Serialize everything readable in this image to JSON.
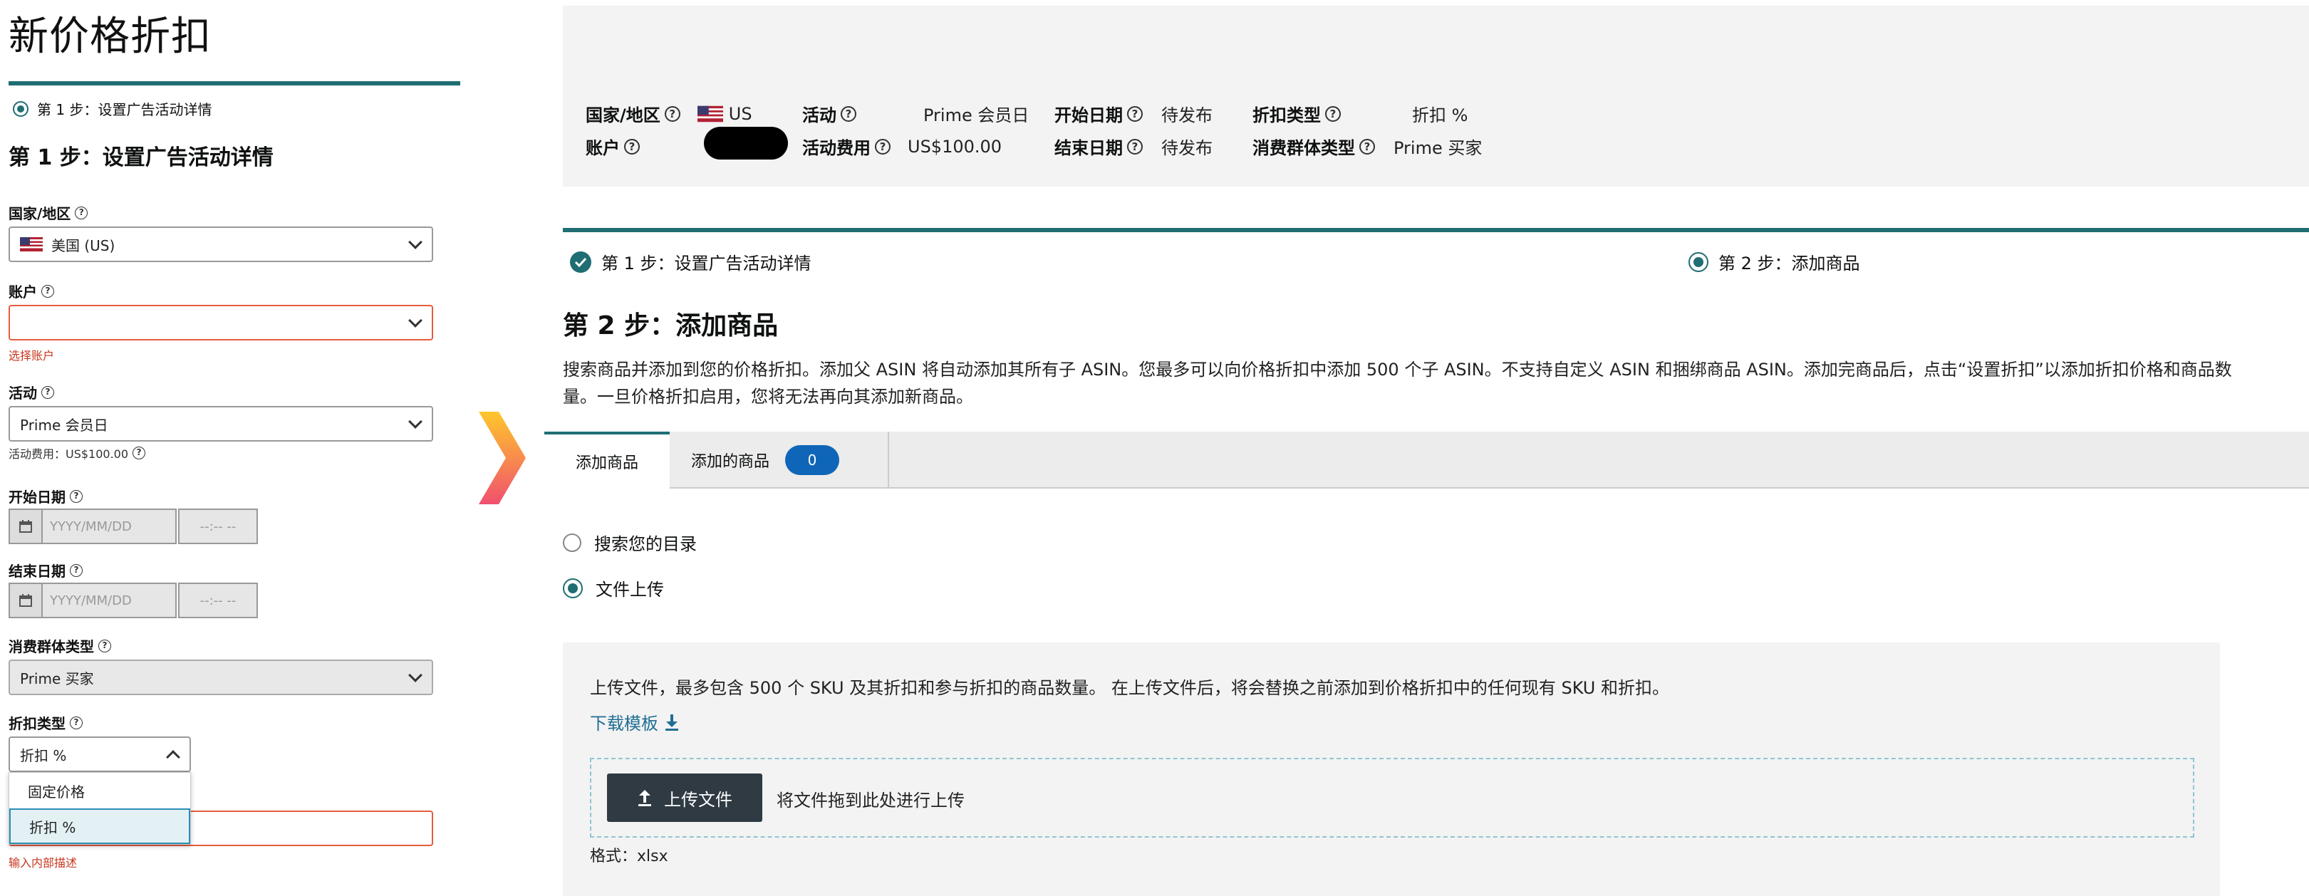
{
  "left": {
    "title": "新价格折扣",
    "step_indicator": "第 1 步：设置广告活动详情",
    "heading": "第 1 步：设置广告活动详情",
    "country_label": "国家/地区",
    "country_value": "美国 (US)",
    "account_label": "账户",
    "account_value": "",
    "account_error": "选择账户",
    "event_label": "活动",
    "event_value": "Prime 会员日",
    "event_fee_text": "活动费用：US$100.00",
    "start_label": "开始日期",
    "start_placeholder": "YYYY/MM/DD",
    "start_time": "--:--  --",
    "end_label": "结束日期",
    "end_placeholder": "YYYY/MM/DD",
    "end_time": "--:--  --",
    "audience_label": "消费群体类型",
    "audience_value": "Prime 买家",
    "discount_type_label": "折扣类型",
    "discount_type_value": "折扣 %",
    "discount_options": [
      "固定价格",
      "折扣 %"
    ],
    "internal_desc_error": "输入内部描述"
  },
  "summary": {
    "country_label": "国家/地区",
    "country_value": "US",
    "account_label": "账户",
    "event_label": "活动",
    "event_value": "Prime 会员日",
    "event_fee_label": "活动费用",
    "event_fee_value": "US$100.00",
    "start_label": "开始日期",
    "start_value": "待发布",
    "end_label": "结束日期",
    "end_value": "待发布",
    "discount_type_label": "折扣类型",
    "discount_type_value": "折扣 %",
    "audience_label": "消费群体类型",
    "audience_value": "Prime 买家"
  },
  "steps": {
    "step1": "第 1 步：设置广告活动详情",
    "step2": "第 2 步：添加商品"
  },
  "main": {
    "heading": "第 2 步：添加商品",
    "description": "搜索商品并添加到您的价格折扣。添加父 ASIN 将自动添加其所有子 ASIN。您最多可以向价格折扣中添加 500 个子 ASIN。不支持自定义 ASIN 和捆绑商品 ASIN。添加完商品后，点击“设置折扣”以添加折扣价格和商品数量。一旦价格折扣启用，您将无法再向其添加新商品。",
    "tabs": {
      "add": "添加商品",
      "added": "添加的商品",
      "added_count": "0"
    },
    "option_search": "搜索您的目录",
    "option_upload": "文件上传",
    "upload_desc": "上传文件，最多包含 500 个 SKU 及其折扣和参与折扣的商品数量。 在上传文件后，将会替换之前添加到价格折扣中的任何现有 SKU 和折扣。",
    "download_template": "下载模板",
    "upload_button": "上传文件",
    "drop_text": "将文件拖到此处进行上传",
    "format_text": "格式：xlsx"
  },
  "colors": {
    "teal": "#1f6e73",
    "error": "#c7361e",
    "badge": "#0f66b8",
    "button": "#2f3a42",
    "link": "#1f6e93",
    "arrow_top": "#ffc72c",
    "arrow_bottom": "#f0506e"
  },
  "icons": [
    "help-icon",
    "us-flag-icon",
    "calendar-icon",
    "chevron-down-icon",
    "chevron-up-icon",
    "check-icon",
    "download-icon",
    "upload-icon",
    "arrow-icon"
  ]
}
